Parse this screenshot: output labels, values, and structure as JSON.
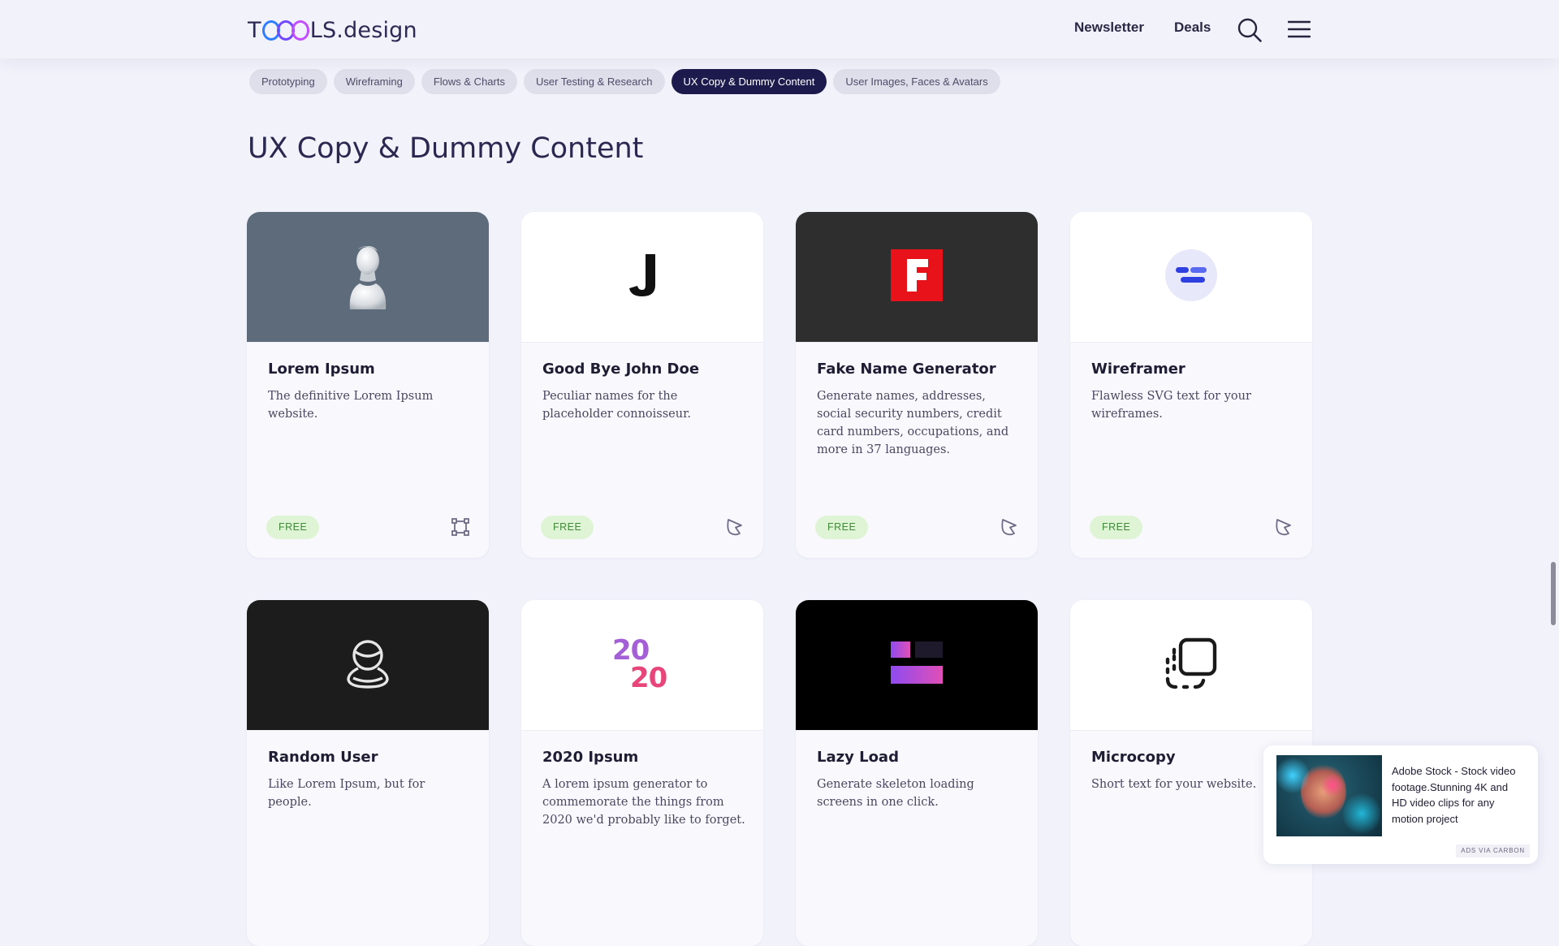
{
  "logo": {
    "before": "T",
    "after": "LS.design"
  },
  "nav": {
    "newsletter": "Newsletter",
    "deals": "Deals"
  },
  "icons": {
    "search": "search-icon",
    "menu": "hamburger-menu-icon"
  },
  "categories": [
    "Prototyping",
    "Wireframing",
    "Flows & Charts",
    "User Testing & Research",
    "UX Copy & Dummy Content",
    "User Images, Faces & Avatars"
  ],
  "active_category": "UX Copy & Dummy Content",
  "page_title": "UX Copy & Dummy Content",
  "cards": [
    {
      "title": "Lorem Ipsum",
      "description": "The definitive Lorem Ipsum website.",
      "badge": "FREE",
      "icon": "figma-frame-icon",
      "thumb_color": "#5e6b7a"
    },
    {
      "title": "Good Bye John Doe",
      "description": "Peculiar names for the placeholder connoisseur.",
      "badge": "FREE",
      "icon": "web-pointer-icon",
      "thumb_color": "#ffffff"
    },
    {
      "title": "Fake Name Generator",
      "description": "Generate names, addresses, social security numbers, credit card numbers, occupations, and more in 37 languages.",
      "badge": "FREE",
      "icon": "web-pointer-icon",
      "thumb_color": "#2e2e2e"
    },
    {
      "title": "Wireframer",
      "description": "Flawless SVG text for your wireframes.",
      "badge": "FREE",
      "icon": "web-pointer-icon",
      "thumb_color": "#ffffff"
    },
    {
      "title": "Random User",
      "description": "Like Lorem Ipsum, but for people.",
      "thumb_color": "#1c1c1c"
    },
    {
      "title": "2020 Ipsum",
      "description": "A lorem ipsum generator to commemorate the things from 2020 we'd probably like to forget.",
      "thumb_color": "#ffffff",
      "logo_text_top": "20",
      "logo_text_bottom": "20"
    },
    {
      "title": "Lazy Load",
      "description": "Generate skeleton loading screens in one click.",
      "thumb_color": "#000000"
    },
    {
      "title": "Microcopy",
      "description": "Short text for your website.",
      "thumb_color": "#ffffff"
    }
  ],
  "ad": {
    "text": "Adobe Stock - Stock video footage.Stunning 4K and HD video clips for any motion project",
    "via": "ADS VIA CARBON"
  }
}
